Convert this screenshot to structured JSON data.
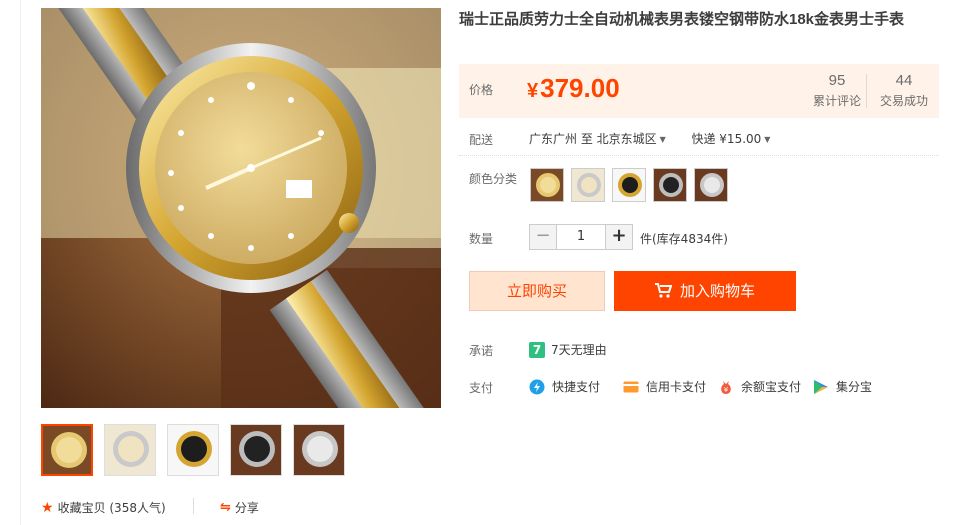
{
  "product": {
    "title": "瑞士正品质劳力士全自动机械表男表镂空钢带防水18k金表男士手表"
  },
  "price": {
    "label": "价格",
    "currency": "¥",
    "amount": "379.00",
    "reviews_count": "95",
    "reviews_label": "累计评论",
    "sales_count": "44",
    "sales_label": "交易成功"
  },
  "shipping": {
    "label": "配送",
    "from": "广东广州 至",
    "to": "北京东城区",
    "method": "快递 ¥15.00"
  },
  "color": {
    "label": "颜色分类",
    "options": [
      "gold-dial",
      "silver-gold-dial",
      "black-gold-dial",
      "black-dial",
      "silver-dial"
    ]
  },
  "quantity": {
    "label": "数量",
    "value": "1",
    "minus": "−",
    "plus": "+",
    "stock_text": "件(库存4834件)"
  },
  "actions": {
    "buy_now": "立即购买",
    "add_to_cart": "加入购物车"
  },
  "promise": {
    "label": "承诺",
    "badge": "7",
    "text": "7天无理由"
  },
  "payment": {
    "label": "支付",
    "methods": [
      "快捷支付",
      "信用卡支付",
      "余额宝支付",
      "集分宝"
    ]
  },
  "footer": {
    "favorite": "收藏宝贝 (358人气)",
    "share": "分享"
  },
  "colors": {
    "accent": "#ff4400",
    "price_bg": "#fff2e8",
    "buy_bg": "#ffe4d0",
    "promise_green": "#2fc081"
  }
}
